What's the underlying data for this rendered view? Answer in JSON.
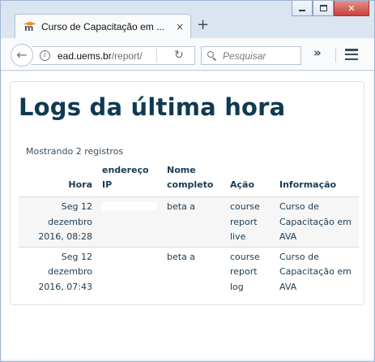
{
  "browser": {
    "tab_title": "Curso de Capacitação em ...",
    "tab_close": "×",
    "new_tab": "+",
    "url_host": "ead.uems.br",
    "url_path": "/report/",
    "search_placeholder": "Pesquisar",
    "overflow_glyph": "»"
  },
  "page": {
    "title": "Logs da última hora",
    "count_text": "Mostrando 2 registros"
  },
  "table": {
    "headers": {
      "time": "Hora",
      "ip": "endereço IP",
      "fullname": "Nome completo",
      "action": "Ação",
      "info": "Informação"
    },
    "rows": [
      {
        "time": "Seg 12 dezembro 2016, 08:28",
        "ip": "",
        "fullname": "beta a",
        "action": "course report live",
        "info": "Curso de Capacitação em AVA"
      },
      {
        "time": "Seg 12 dezembro 2016, 07:43",
        "ip": "",
        "fullname": "beta a",
        "action": "course report log",
        "info": "Curso de Capacitação em AVA"
      }
    ]
  },
  "colors": {
    "title": "#0e3a52",
    "text": "#1b3b52",
    "row_stripe": "#f6f6f6",
    "close_button": "#c7433a"
  }
}
